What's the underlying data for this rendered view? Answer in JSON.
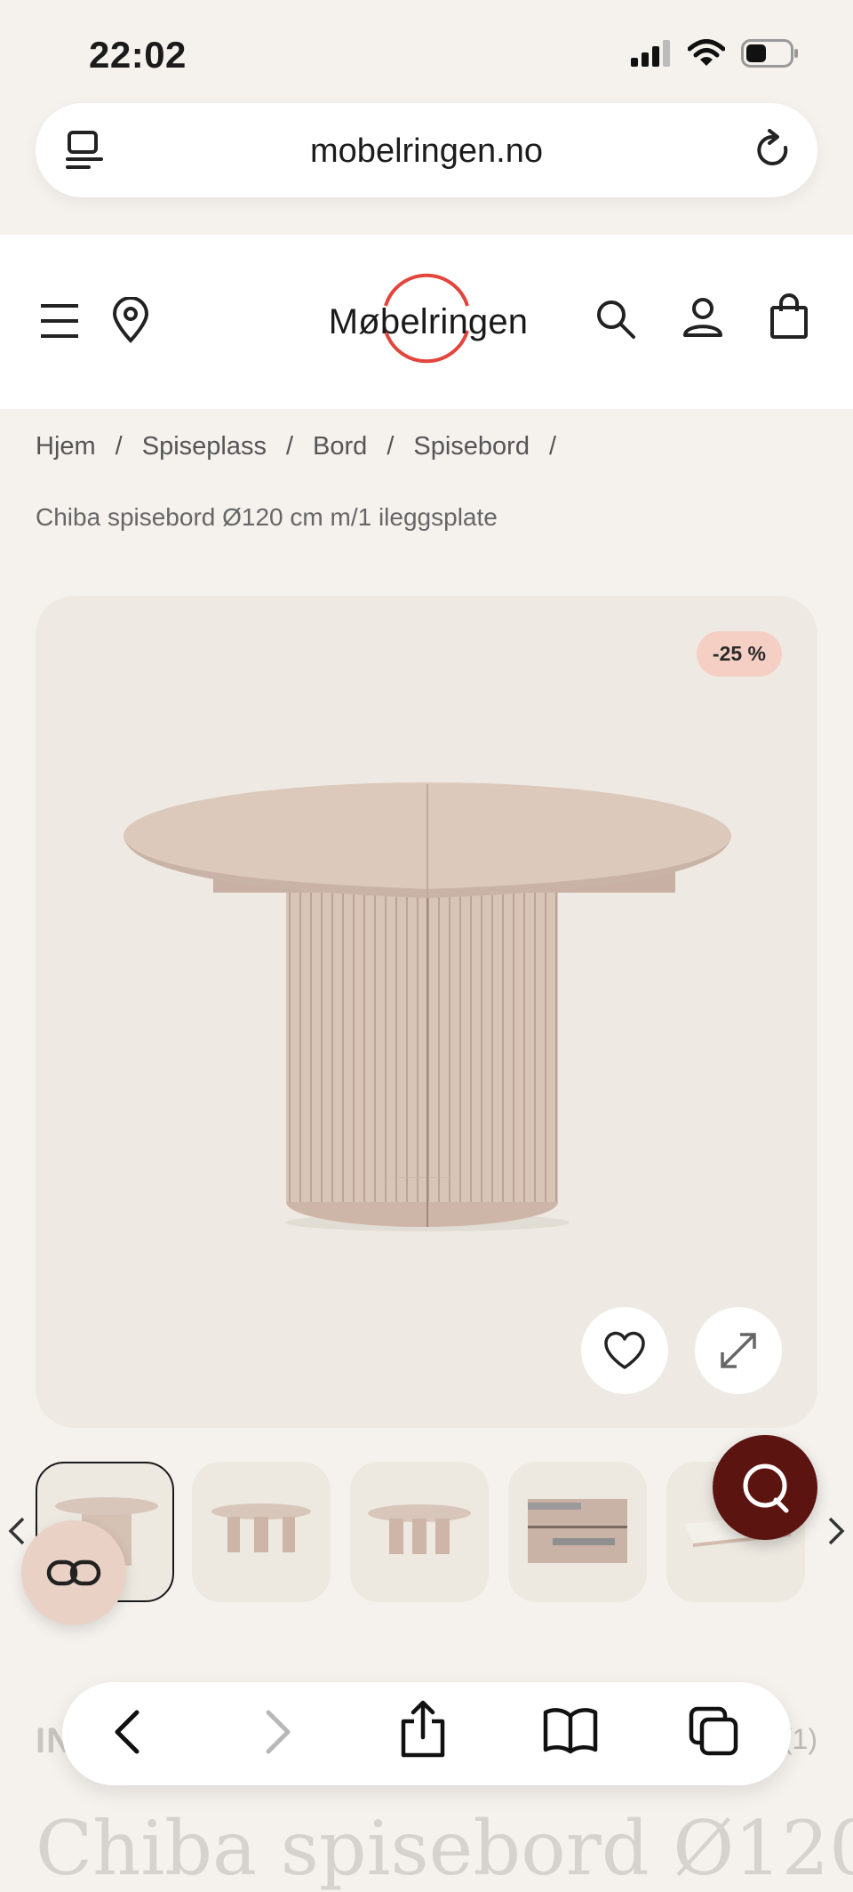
{
  "status_bar": {
    "time": "22:02"
  },
  "browser": {
    "url": "mobelringen.no"
  },
  "site": {
    "logo_text": "Møbelringen",
    "brand_color": "#e2453c"
  },
  "breadcrumb": {
    "items": [
      "Hjem",
      "Spiseplass",
      "Bord",
      "Spisebord"
    ],
    "separator": "/",
    "current": "Chiba spisebord Ø120 cm m/1 ileggsplate"
  },
  "product": {
    "discount_badge": "-25 %",
    "brand_partial": "IN",
    "rating_count": "(1)",
    "title_partial": "Chiba spisebord Ø120"
  },
  "thumbnails": {
    "count": 5,
    "selected_index": 0
  },
  "icons": {
    "menu": "menu-icon",
    "location": "location-icon",
    "search": "search-icon",
    "account": "account-icon",
    "cart": "cart-icon",
    "favorite": "heart-icon",
    "expand": "expand-icon",
    "chat": "chat-icon",
    "compare": "compare-icon"
  }
}
